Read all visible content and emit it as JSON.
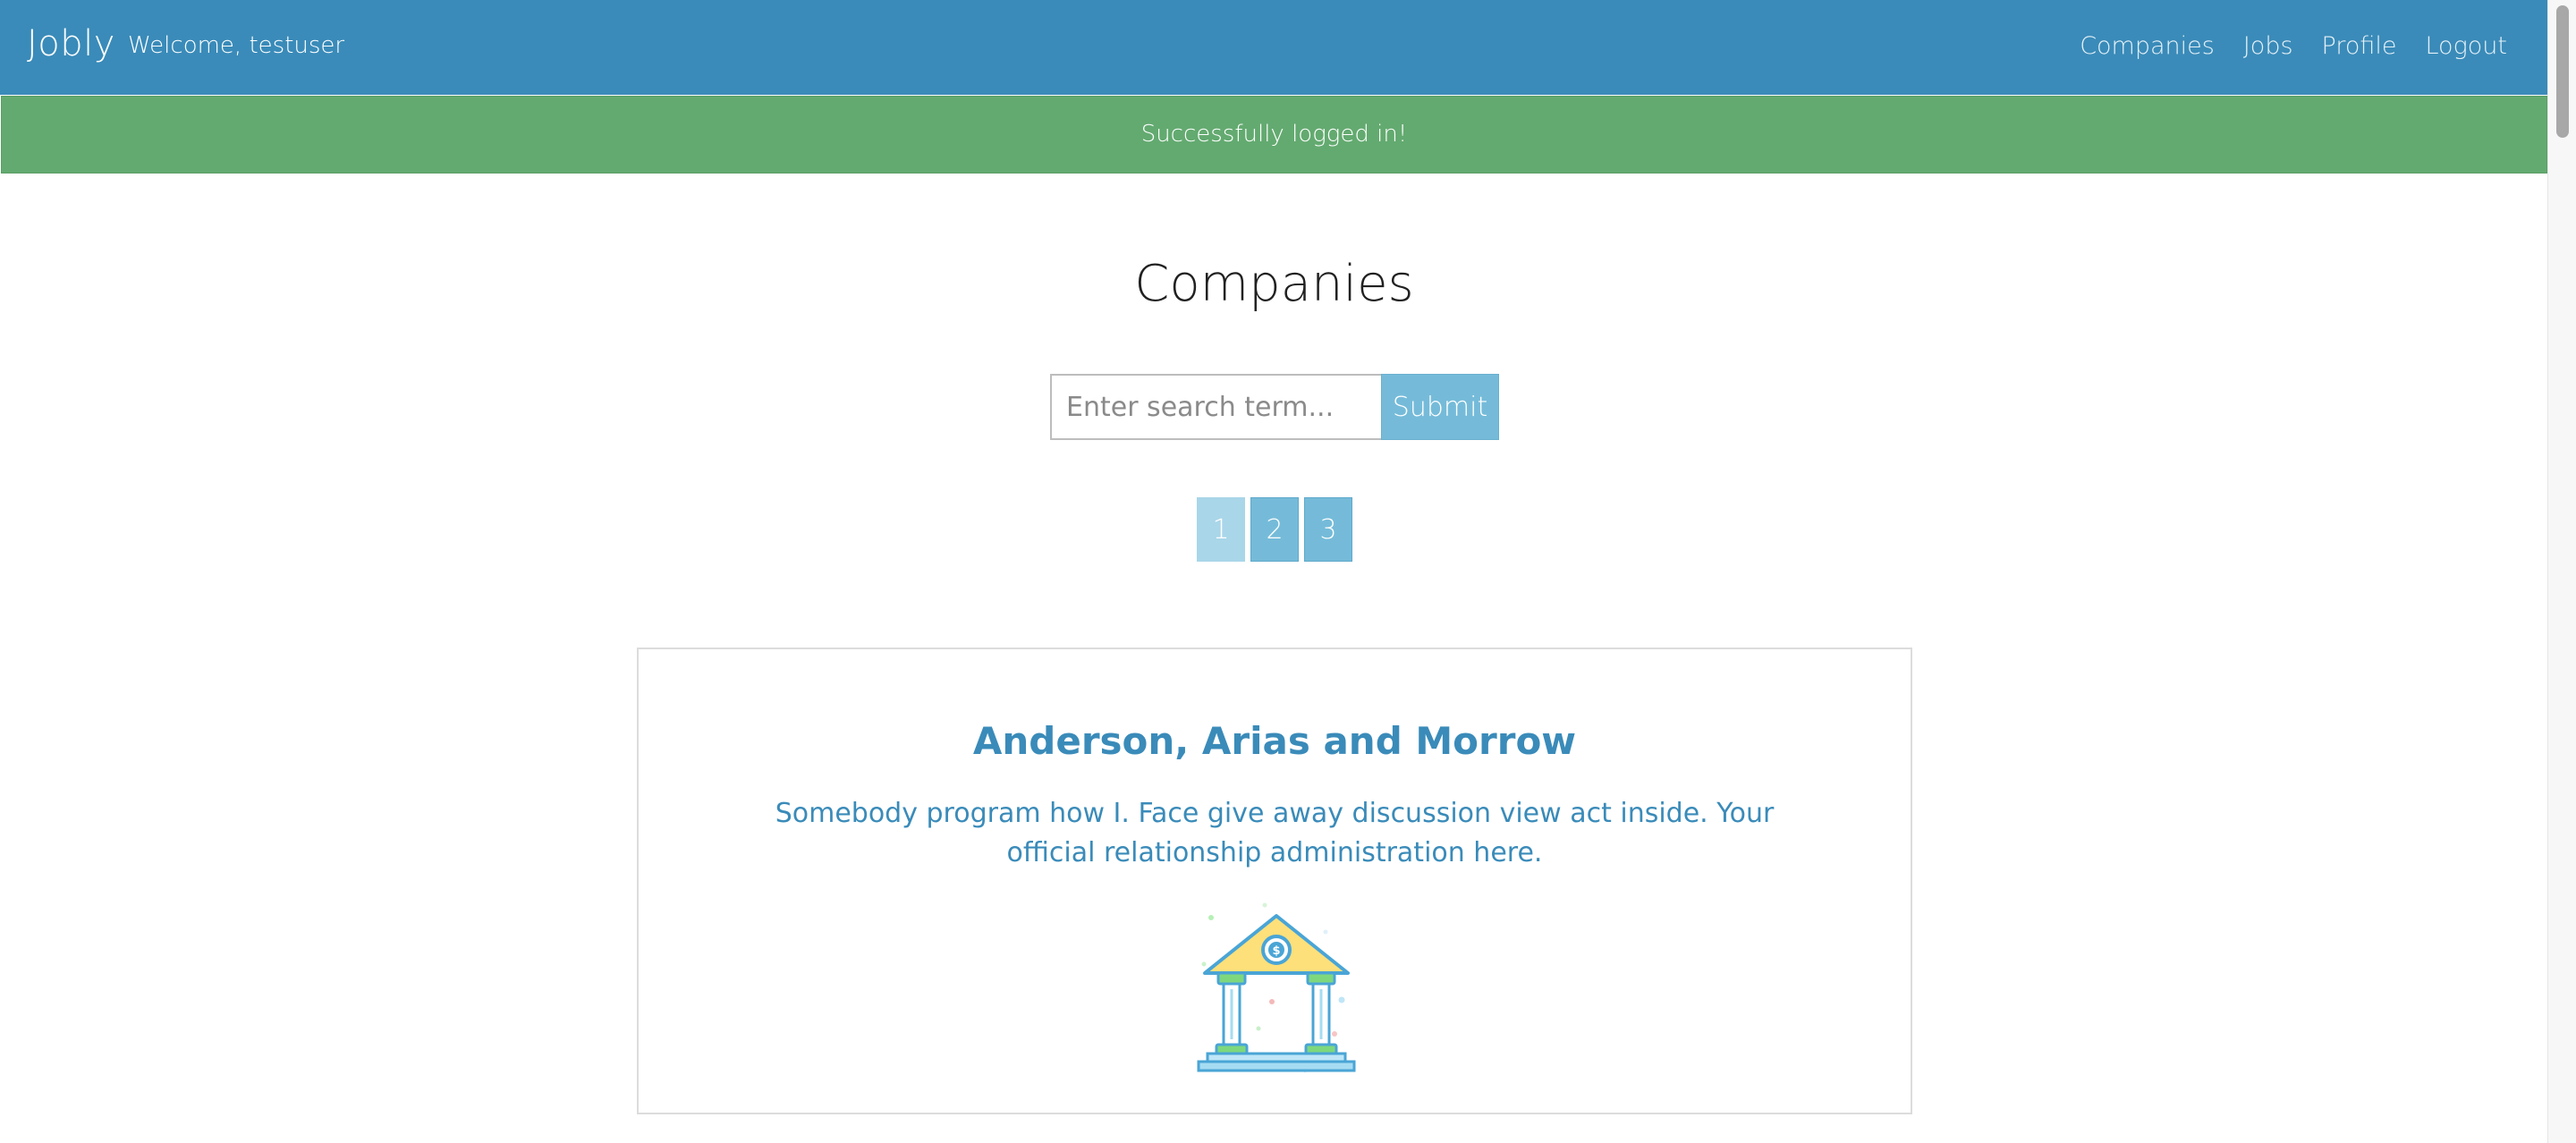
{
  "navbar": {
    "brand": "Jobly",
    "welcome": "Welcome, testuser",
    "links": {
      "companies": "Companies",
      "jobs": "Jobs",
      "profile": "Profile",
      "logout": "Logout"
    },
    "background_color": "#3a8bb9"
  },
  "alert": {
    "message": "Successfully logged in!",
    "color": "#63aa70"
  },
  "main": {
    "title": "Companies",
    "search": {
      "placeholder": "Enter search term...",
      "value": "",
      "submit_label": "Submit"
    },
    "pagination": {
      "pages": [
        "1",
        "2",
        "3"
      ],
      "current": "1"
    },
    "companies": [
      {
        "name": "Anderson, Arias and Morrow",
        "description": "Somebody program how I. Face give away discussion view act inside. Your official relationship administration here.",
        "logo_icon": "bank-icon"
      }
    ]
  }
}
